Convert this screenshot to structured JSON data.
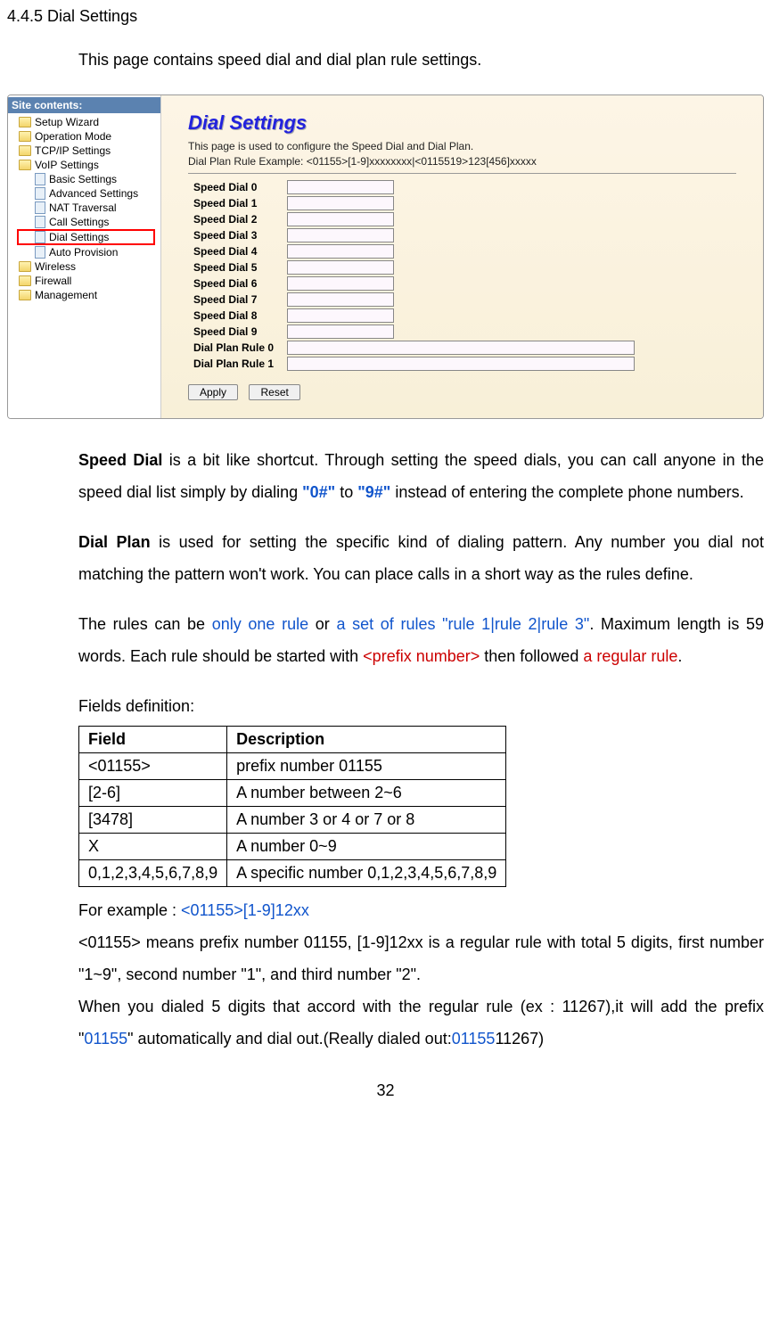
{
  "heading": "4.4.5 Dial Settings",
  "intro": "This page contains speed dial and dial plan rule settings.",
  "sidebar": {
    "title": "Site contents:",
    "items": [
      {
        "label": "Setup Wizard",
        "type": "folder",
        "level": 1
      },
      {
        "label": "Operation Mode",
        "type": "folder",
        "level": 1
      },
      {
        "label": "TCP/IP Settings",
        "type": "folder",
        "level": 1
      },
      {
        "label": "VoIP Settings",
        "type": "folder-open",
        "level": 1
      },
      {
        "label": "Basic Settings",
        "type": "page",
        "level": 2
      },
      {
        "label": "Advanced Settings",
        "type": "page",
        "level": 2
      },
      {
        "label": "NAT Traversal",
        "type": "page",
        "level": 2
      },
      {
        "label": "Call Settings",
        "type": "page",
        "level": 2
      },
      {
        "label": "Dial Settings",
        "type": "page",
        "level": 2,
        "highlight": true
      },
      {
        "label": "Auto Provision",
        "type": "page",
        "level": 2
      },
      {
        "label": "Wireless",
        "type": "folder",
        "level": 1
      },
      {
        "label": "Firewall",
        "type": "folder",
        "level": 1
      },
      {
        "label": "Management",
        "type": "folder",
        "level": 1
      }
    ]
  },
  "panel": {
    "title": "Dial Settings",
    "desc": "This page is used to configure the Speed Dial and Dial Plan.",
    "example": "Dial Plan Rule Example: <01155>[1-9]xxxxxxxx|<0115519>123[456]xxxxx",
    "rows": [
      {
        "label": "Speed Dial 0",
        "cls": "short"
      },
      {
        "label": "Speed Dial 1",
        "cls": "short"
      },
      {
        "label": "Speed Dial 2",
        "cls": "short"
      },
      {
        "label": "Speed Dial 3",
        "cls": "short"
      },
      {
        "label": "Speed Dial 4",
        "cls": "short"
      },
      {
        "label": "Speed Dial 5",
        "cls": "short"
      },
      {
        "label": "Speed Dial 6",
        "cls": "short"
      },
      {
        "label": "Speed Dial 7",
        "cls": "short"
      },
      {
        "label": "Speed Dial 8",
        "cls": "short"
      },
      {
        "label": "Speed Dial 9",
        "cls": "short"
      },
      {
        "label": "Dial Plan Rule 0",
        "cls": "long"
      },
      {
        "label": "Dial Plan Rule 1",
        "cls": "long"
      }
    ],
    "apply": "Apply",
    "reset": "Reset"
  },
  "para_speed": {
    "lead": "Speed Dial",
    "t1": " is a bit like shortcut. Through setting the speed dials, you can call anyone in the speed dial list simply by dialing ",
    "q0": "\"0#\"",
    "t2": " to ",
    "q9": "\"9#\"",
    "t3": " instead of entering the complete phone numbers."
  },
  "para_dialplan": {
    "lead": "Dial Plan",
    "t1": " is used for setting the specific kind of dialing pattern. Any number you dial not matching the pattern won't work. You can place calls in a short way as the rules define."
  },
  "para_rules": {
    "t1": "The rules can be ",
    "r1": "only one rule",
    "t2": " or ",
    "r2": "a set of rules \"rule 1|rule 2|rule 3\"",
    "t3": ". Maximum length is 59 words. Each rule should be started with ",
    "r3": "<prefix number>",
    "t4": " then followed ",
    "r4": "a regular rule",
    "t5": "."
  },
  "fields_label": "Fields definition:",
  "table": {
    "h1": "Field",
    "h2": "Description",
    "rows": [
      {
        "f": "<01155>",
        "d": "prefix number 01155"
      },
      {
        "f": "[2-6]",
        "d": "A number between 2~6"
      },
      {
        "f": "[3478]",
        "d": "A number 3 or 4 or 7 or 8"
      },
      {
        "f": "X",
        "d": "A number 0~9"
      },
      {
        "f": "0,1,2,3,4,5,6,7,8,9",
        "d": "A specific number 0,1,2,3,4,5,6,7,8,9"
      }
    ]
  },
  "example_block": {
    "l1a": "For example :   ",
    "l1b": "<01155>[1-9]12xx",
    "l2": "<01155> means prefix number 01155, [1-9]12xx is a regular rule with total 5 digits, first number \"1~9\", second number \"1\", and third number \"2\".",
    "l3a": "When you dialed 5 digits that accord with the regular rule (ex : 11267),it will add the prefix \"",
    "l3b": "01155",
    "l3c": "\" automatically and dial out.(Really dialed out:",
    "l3d": "01155",
    "l3e": "11267)"
  },
  "page_number": "32"
}
